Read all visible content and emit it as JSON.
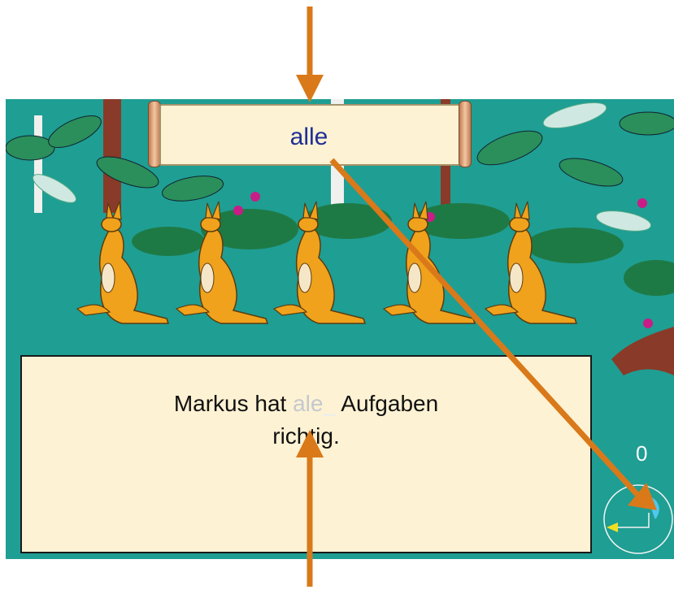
{
  "scroll_word": "alle",
  "sentence": {
    "before": "Markus hat ",
    "typed": "ale",
    "cursor": "_",
    "after": " Aufgaben",
    "line2": "richtig."
  },
  "score": "0",
  "colors": {
    "background": "#1f9e93",
    "scroll": "#fdf2d3",
    "word": "#1f2f95",
    "arrow": "#d9791a",
    "kangaroo": "#f0a21c"
  },
  "icons": [
    "kangaroo-icon",
    "dial-icon",
    "feather-icon",
    "back-arrow-icon"
  ]
}
